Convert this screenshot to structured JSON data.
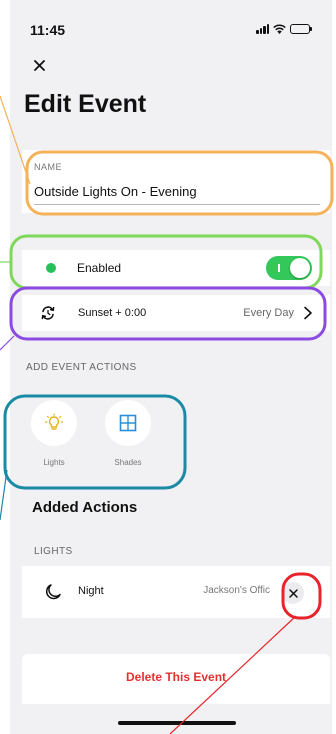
{
  "status_bar": {
    "time": "11:45",
    "icons": [
      "signal-icon",
      "wifi-icon",
      "battery-icon"
    ]
  },
  "header": {
    "close_icon": "close-icon",
    "title": "Edit Event"
  },
  "name_field": {
    "label": "NAME",
    "value": "Outside Lights On - Evening"
  },
  "enabled_row": {
    "label": "Enabled",
    "on": true,
    "status_color": "#25c05a"
  },
  "schedule_row": {
    "icon": "schedule-sync-icon",
    "trigger": "Sunset + 0:00",
    "repeat": "Every Day"
  },
  "add_actions": {
    "heading": "ADD EVENT ACTIONS",
    "items": [
      {
        "label": "Lights",
        "icon": "lightbulb-icon"
      },
      {
        "label": "Shades",
        "icon": "shades-icon"
      }
    ]
  },
  "added_actions": {
    "heading": "Added Actions",
    "groups": [
      {
        "label": "LIGHTS",
        "items": [
          {
            "icon": "moon-icon",
            "name": "Night",
            "room": "Jackson's Offic"
          }
        ]
      }
    ]
  },
  "delete_button": {
    "label": "Delete This Event",
    "color": "#e53030"
  },
  "annotation_colors": {
    "name": "#f4b259",
    "enabled": "#7fd85a",
    "schedule": "#8c4be0",
    "actions": "#1a8aa5",
    "remove": "#e8242a"
  }
}
